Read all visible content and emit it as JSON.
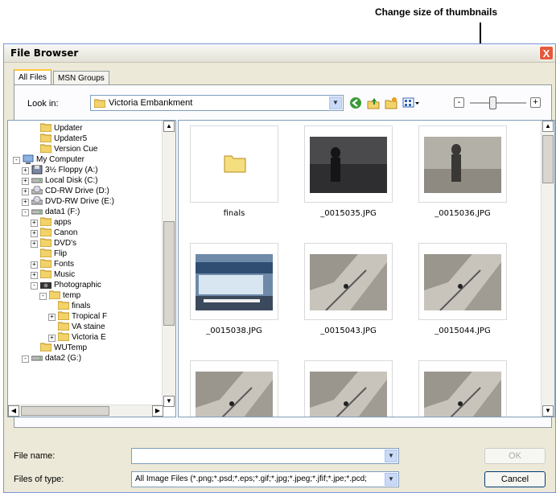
{
  "callout": "Change size of thumbnails",
  "window": {
    "title": "File Browser",
    "close": "X"
  },
  "tabs": [
    {
      "label": "All Files"
    },
    {
      "label": "MSN Groups"
    }
  ],
  "lookin": {
    "label": "Look in:",
    "value": "Victoria Embankment"
  },
  "icons": {
    "back": "←",
    "up": "↑",
    "newfolder": "★",
    "views": "▦",
    "zoom_out": "-",
    "zoom_in": "+",
    "dropdown": "▼",
    "folder": "📁"
  },
  "thumbnail_zoom_level": 0.4,
  "tree": [
    {
      "label": "Updater",
      "indent": 3,
      "icon": "folder"
    },
    {
      "label": "Updater5",
      "indent": 3,
      "icon": "folder"
    },
    {
      "label": "Version Cue",
      "indent": 3,
      "icon": "folder"
    },
    {
      "label": "My Computer",
      "indent": 1,
      "icon": "computer",
      "exp": "-"
    },
    {
      "label": "3½ Floppy (A:)",
      "indent": 2,
      "icon": "floppy",
      "exp": "+"
    },
    {
      "label": "Local Disk (C:)",
      "indent": 2,
      "icon": "disk",
      "exp": "+"
    },
    {
      "label": "CD-RW Drive (D:)",
      "indent": 2,
      "icon": "cd",
      "exp": "+"
    },
    {
      "label": "DVD-RW Drive (E:)",
      "indent": 2,
      "icon": "cd",
      "exp": "+"
    },
    {
      "label": "data1 (F:)",
      "indent": 2,
      "icon": "disk",
      "exp": "-"
    },
    {
      "label": "apps",
      "indent": 3,
      "icon": "folder",
      "exp": "+"
    },
    {
      "label": "Canon",
      "indent": 3,
      "icon": "folder",
      "exp": "+"
    },
    {
      "label": "DVD's",
      "indent": 3,
      "icon": "folder",
      "exp": "+"
    },
    {
      "label": "Flip",
      "indent": 3,
      "icon": "folder"
    },
    {
      "label": "Fonts",
      "indent": 3,
      "icon": "folder",
      "exp": "+"
    },
    {
      "label": "Music",
      "indent": 3,
      "icon": "folder",
      "exp": "+"
    },
    {
      "label": "Photographic",
      "indent": 3,
      "icon": "camera",
      "exp": "-"
    },
    {
      "label": "temp",
      "indent": 4,
      "icon": "folder",
      "exp": "-"
    },
    {
      "label": "finals",
      "indent": 5,
      "icon": "folder"
    },
    {
      "label": "Tropical F",
      "indent": 5,
      "icon": "folder",
      "exp": "+"
    },
    {
      "label": "VA staine",
      "indent": 5,
      "icon": "folder"
    },
    {
      "label": "Victoria E",
      "indent": 5,
      "icon": "folder",
      "exp": "+"
    },
    {
      "label": "WUTemp",
      "indent": 3,
      "icon": "folder"
    },
    {
      "label": "data2 (G:)",
      "indent": 2,
      "icon": "disk",
      "exp": "-"
    }
  ],
  "thumbnails": [
    {
      "label": "finals",
      "kind": "folder"
    },
    {
      "label": "_0015035.JPG",
      "kind": "photo-shadow-dark"
    },
    {
      "label": "_0015036.JPG",
      "kind": "photo-shadow-light"
    },
    {
      "label": "_0015038.JPG",
      "kind": "photo-street"
    },
    {
      "label": "_0015043.JPG",
      "kind": "photo-tilted"
    },
    {
      "label": "_0015044.JPG",
      "kind": "photo-tilted"
    },
    {
      "label": "",
      "kind": "photo-tilted"
    },
    {
      "label": "",
      "kind": "photo-tilted"
    },
    {
      "label": "",
      "kind": "photo-tilted"
    }
  ],
  "filename": {
    "label": "File name:",
    "value": ""
  },
  "filetype": {
    "label": "Files of type:",
    "value": "All Image Files (*.png;*.psd;*.eps;*.gif;*.jpg;*.jpeg;*.jfif;*.jpe;*.pcd;"
  },
  "buttons": {
    "ok": "OK",
    "cancel": "Cancel"
  }
}
